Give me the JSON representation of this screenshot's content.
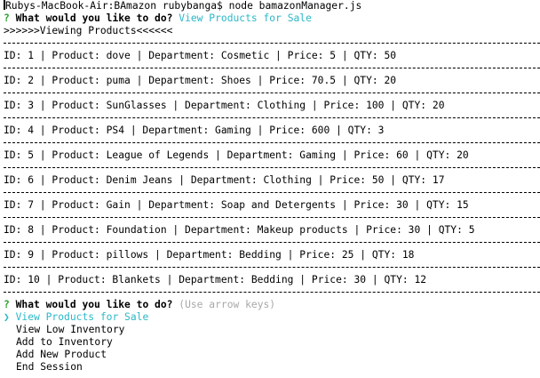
{
  "prompt_line": {
    "host": "Rubys-MacBook-Air:BAmazon rubybanga$",
    "command": "node bamazonManager.js"
  },
  "first_question": {
    "mark": "?",
    "text": "What would you like to do?",
    "answer": "View Products for Sale"
  },
  "viewing_banner": ">>>>>>Viewing Products<<<<<<",
  "products": [
    {
      "row": "ID: 1 | Product: dove | Department: Cosmetic | Price: 5 | QTY: 50"
    },
    {
      "row": "ID: 2 | Product: puma | Department: Shoes | Price: 70.5 | QTY: 20"
    },
    {
      "row": "ID: 3 | Product: SunGlasses | Department: Clothing | Price: 100 | QTY: 20"
    },
    {
      "row": "ID: 4 | Product: PS4 | Department: Gaming | Price: 600 | QTY: 3"
    },
    {
      "row": "ID: 5 | Product: League of Legends | Department: Gaming | Price: 60 | QTY: 20"
    },
    {
      "row": "ID: 6 | Product: Denim Jeans | Department: Clothing | Price: 50 | QTY: 17"
    },
    {
      "row": "ID: 7 | Product: Gain | Department: Soap and Detergents | Price: 30 | QTY: 15"
    },
    {
      "row": "ID: 8 | Product: Foundation | Department: Makeup products | Price: 30 | QTY: 5"
    },
    {
      "row": "ID: 9 | Product: pillows | Department: Bedding | Price: 25 | QTY: 18"
    },
    {
      "row": "ID: 10 | Product: Blankets | Department: Bedding | Price: 30 | QTY: 12"
    }
  ],
  "second_question": {
    "mark": "?",
    "text": "What would you like to do?",
    "hint": "(Use arrow keys)"
  },
  "menu": {
    "pointer": "❯",
    "items": [
      "View Products for Sale",
      "View Low Inventory",
      "Add to Inventory",
      "Add New Product",
      "End Session"
    ],
    "selected_index": 0
  },
  "colors": {
    "question_mark": "#2aa02a",
    "answer": "#2ab8c8",
    "hint": "#a8a8a8",
    "selected": "#2ab8c8"
  }
}
